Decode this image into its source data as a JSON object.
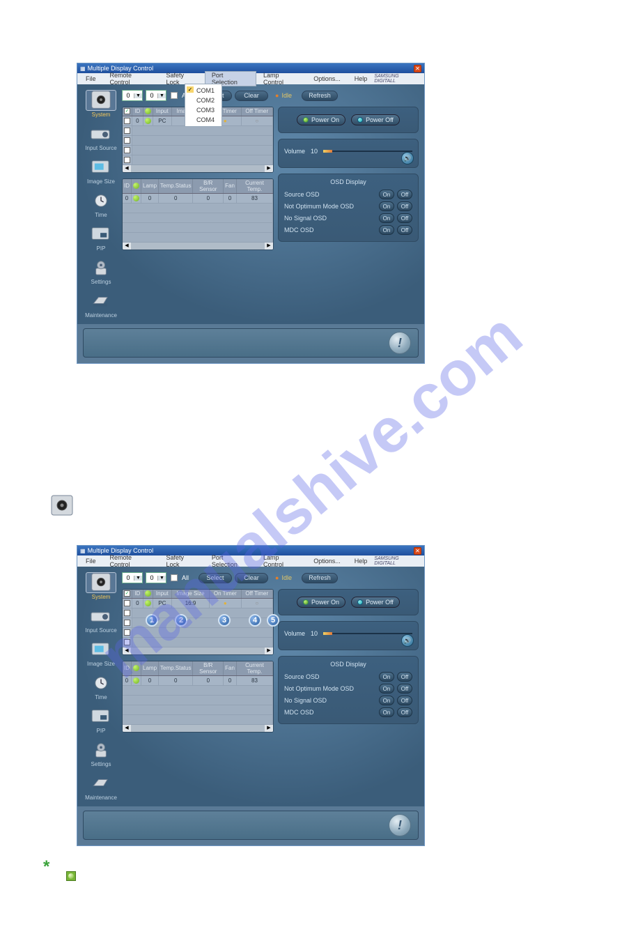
{
  "watermark": "manualshive.com",
  "app": {
    "title": "Multiple Display Control",
    "brand": "SAMSUNG DIGITALL",
    "menu": [
      "File",
      "Remote Control",
      "Safety Lock",
      "Port Selection",
      "Lamp Control",
      "Options...",
      "Help"
    ],
    "port_dropdown": [
      "COM1",
      "COM2",
      "COM3",
      "COM4"
    ],
    "toolbar": {
      "range1": "0",
      "range2": "0",
      "all": "All",
      "select": "Select",
      "clear": "Clear",
      "idle": "Idle",
      "refresh": "Refresh"
    },
    "sidebar": [
      "System",
      "Input Source",
      "Image Size",
      "Time",
      "PIP",
      "Settings",
      "Maintenance"
    ],
    "grid1": {
      "headers": [
        "",
        "ID",
        "",
        "Input",
        "Image Size",
        "On Timer",
        "Off Timer"
      ],
      "row": {
        "id": "0",
        "input": "PC",
        "imagesize": "16:9",
        "ontimer_dot": true,
        "offtimer_dot": true
      }
    },
    "grid2": {
      "headers": [
        "ID",
        "",
        "Lamp",
        "Temp.Status",
        "B/R Sensor",
        "Fan",
        "Current Temp."
      ],
      "row": {
        "id": "0",
        "lamp": "0",
        "tempstatus": "0",
        "brsensor": "0",
        "fan": "0",
        "currenttemp": "83"
      }
    },
    "power": {
      "on": "Power On",
      "off": "Power Off"
    },
    "volume": {
      "label": "Volume",
      "value": "10"
    },
    "osd": {
      "header": "OSD Display",
      "rows": [
        "Source OSD",
        "Not Optimum Mode OSD",
        "No Signal OSD",
        "MDC OSD"
      ],
      "on": "On",
      "off": "Off"
    }
  },
  "annotations": [
    "1",
    "2",
    "3",
    "4",
    "5"
  ],
  "asterisk": "*"
}
